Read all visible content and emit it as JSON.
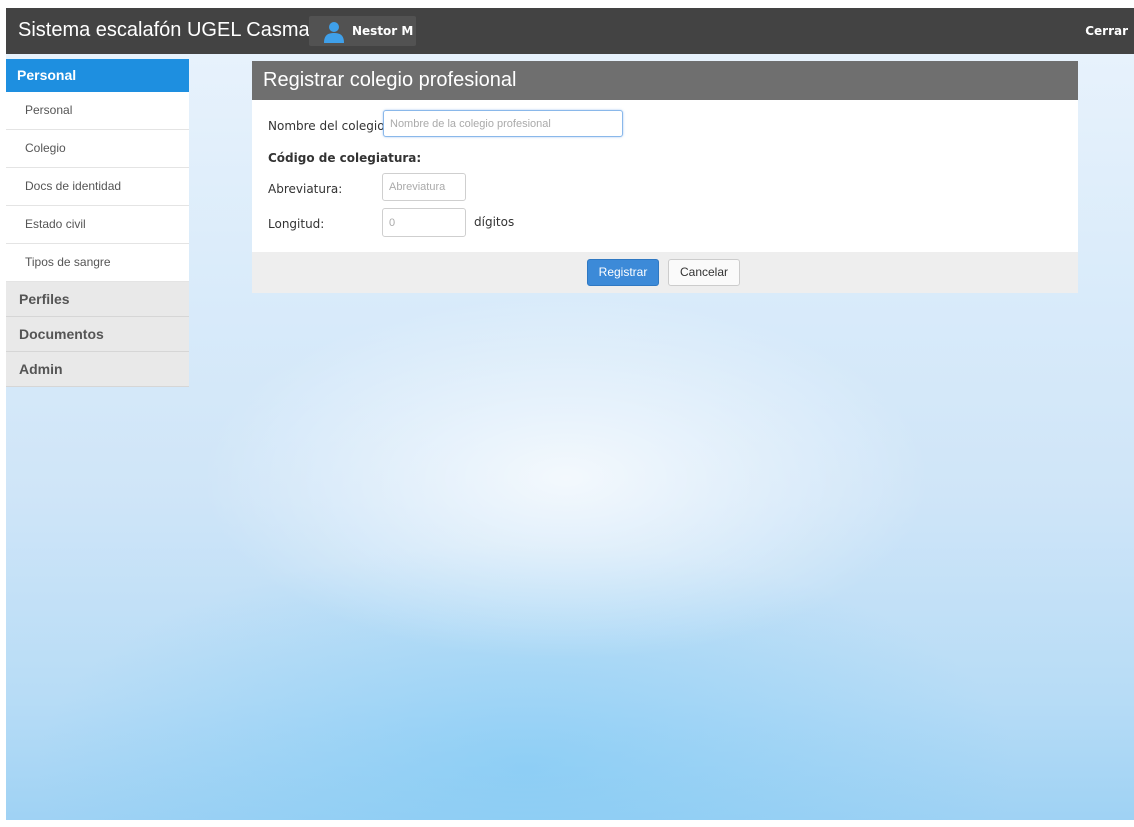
{
  "app": {
    "title": "Sistema escalafón UGEL Casma",
    "user_name": "Nestor M",
    "close_label": "Cerrar"
  },
  "sidebar": {
    "active_section": "Personal",
    "sub_items": [
      "Personal",
      "Colegio",
      "Docs de identidad",
      "Estado civil",
      "Tipos de sangre"
    ],
    "sections": [
      "Perfiles",
      "Documentos",
      "Admin"
    ]
  },
  "form": {
    "title": "Registrar colegio profesional",
    "name_label": "Nombre del colegio:",
    "name_placeholder": "Nombre de la colegio profesional",
    "name_value": "",
    "code_heading": "Código de colegiatura:",
    "abbr_label": "Abreviatura:",
    "abbr_placeholder": "Abreviatura",
    "length_label": "Longitud:",
    "length_placeholder": "0",
    "length_unit": "dígitos",
    "submit_label": "Registrar",
    "cancel_label": "Cancelar"
  },
  "colors": {
    "topbar": "#434343",
    "accent": "#1e8fe0",
    "primary_button": "#3c8ad8",
    "panel_header": "#6f6f6f"
  },
  "icons": {
    "user": "user-icon"
  }
}
